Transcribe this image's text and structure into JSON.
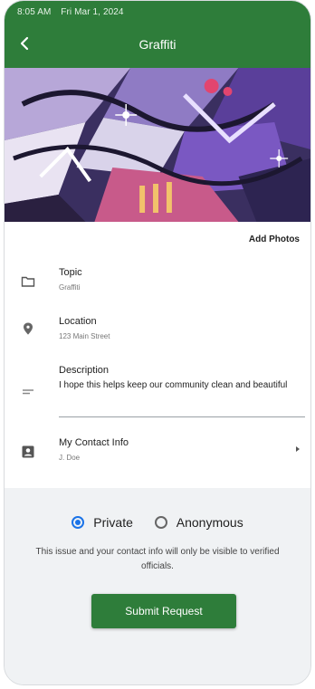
{
  "status_bar": {
    "time": "8:05 AM",
    "date": "Fri Mar 1, 2024"
  },
  "header": {
    "title": "Graffiti",
    "back_icon": "chevron-left-icon"
  },
  "photos": {
    "add_label": "Add Photos"
  },
  "fields": {
    "topic": {
      "label": "Topic",
      "value": "Graffiti",
      "icon": "folder-icon"
    },
    "location": {
      "label": "Location",
      "value": "123 Main Street",
      "icon": "location-pin-icon"
    },
    "description": {
      "label": "Description",
      "value": "I hope this helps keep our community clean and beautiful",
      "icon": "text-lines-icon"
    },
    "contact": {
      "label": "My Contact Info",
      "value": "J. Doe",
      "icon": "contact-card-icon"
    }
  },
  "privacy": {
    "options": [
      {
        "label": "Private",
        "selected": true
      },
      {
        "label": "Anonymous",
        "selected": false
      }
    ],
    "notice": "This issue and your contact info will only be visible to verified officials."
  },
  "submit": {
    "label": "Submit Request"
  },
  "colors": {
    "primary": "#2e7d3a",
    "radio_active": "#1a73e8"
  }
}
